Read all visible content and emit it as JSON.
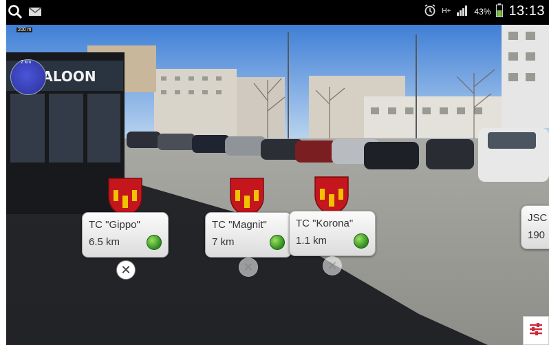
{
  "status_bar": {
    "time": "13:13",
    "battery_percent": "43%",
    "network": "H+",
    "left_icons": [
      "search-icon",
      "message-icon"
    ],
    "right_icons": [
      "alarm-icon",
      "signal-icon",
      "battery-icon"
    ]
  },
  "radar": {
    "range_label": "200 m",
    "distance_label": "2 km"
  },
  "pois": [
    {
      "name": "TC \"Gippo\"",
      "distance": "6.5 km",
      "close_state": "active"
    },
    {
      "name": "TC \"Magnit\"",
      "distance": "7 km",
      "close_state": "faded"
    },
    {
      "name": "TC \"Korona\"",
      "distance": "1.1 km",
      "close_state": "faded"
    },
    {
      "name": "JSC",
      "distance": "190"
    }
  ],
  "scene_signs": {
    "saloon": "SALOON"
  },
  "colors": {
    "emblem_red": "#c4161c",
    "emblem_gold": "#f2c200",
    "status_dot": "#3a9a2a",
    "settings_accent": "#d0283a"
  }
}
